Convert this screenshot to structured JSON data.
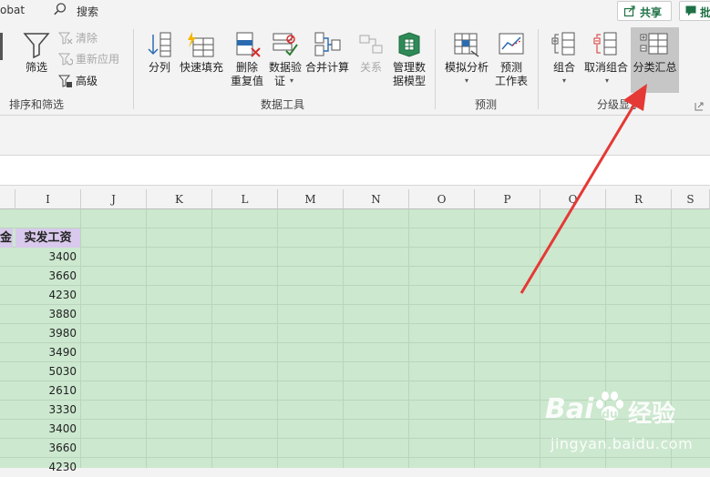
{
  "titlebar": {
    "app_fragment": "obat",
    "search_label": "搜索",
    "share_label": "共享",
    "share2_label": "批"
  },
  "ribbon": {
    "groups": {
      "sort_filter": {
        "label": "排序和筛选",
        "filter": "筛选",
        "clear": "清除",
        "reapply": "重新应用",
        "advanced": "高级"
      },
      "data_tools": {
        "label": "数据工具",
        "split": "分列",
        "flash_fill": "快速填充",
        "remove_dup_1": "删除",
        "remove_dup_2": "重复值",
        "validation_1": "数据验",
        "validation_2": "证",
        "consolidate": "合并计算",
        "relations": "关系",
        "model_1": "管理数",
        "model_2": "据模型"
      },
      "forecast": {
        "label": "预测",
        "what_if": "模拟分析",
        "sheet_1": "预测",
        "sheet_2": "工作表"
      },
      "outline": {
        "label": "分级显示",
        "group": "组合",
        "ungroup": "取消组合",
        "subtotal": "分类汇总"
      }
    }
  },
  "sheet": {
    "columns": [
      "I",
      "J",
      "K",
      "L",
      "M",
      "N",
      "O",
      "P",
      "Q",
      "R",
      "S"
    ],
    "prev_header_fragment": "金",
    "header": "实发工资",
    "values": [
      "3400",
      "3660",
      "4230",
      "3880",
      "3980",
      "3490",
      "5030",
      "2610",
      "3330",
      "3400",
      "3660",
      "4230"
    ]
  },
  "watermark": {
    "brand": "Bai",
    "brand2": "经验",
    "url": "jingyan.baidu.com"
  },
  "colors": {
    "sheet_bg": "#cce8cf",
    "header_fill": "#d9c9ec",
    "arrow": "#e53935",
    "accent": "#1e7145"
  }
}
